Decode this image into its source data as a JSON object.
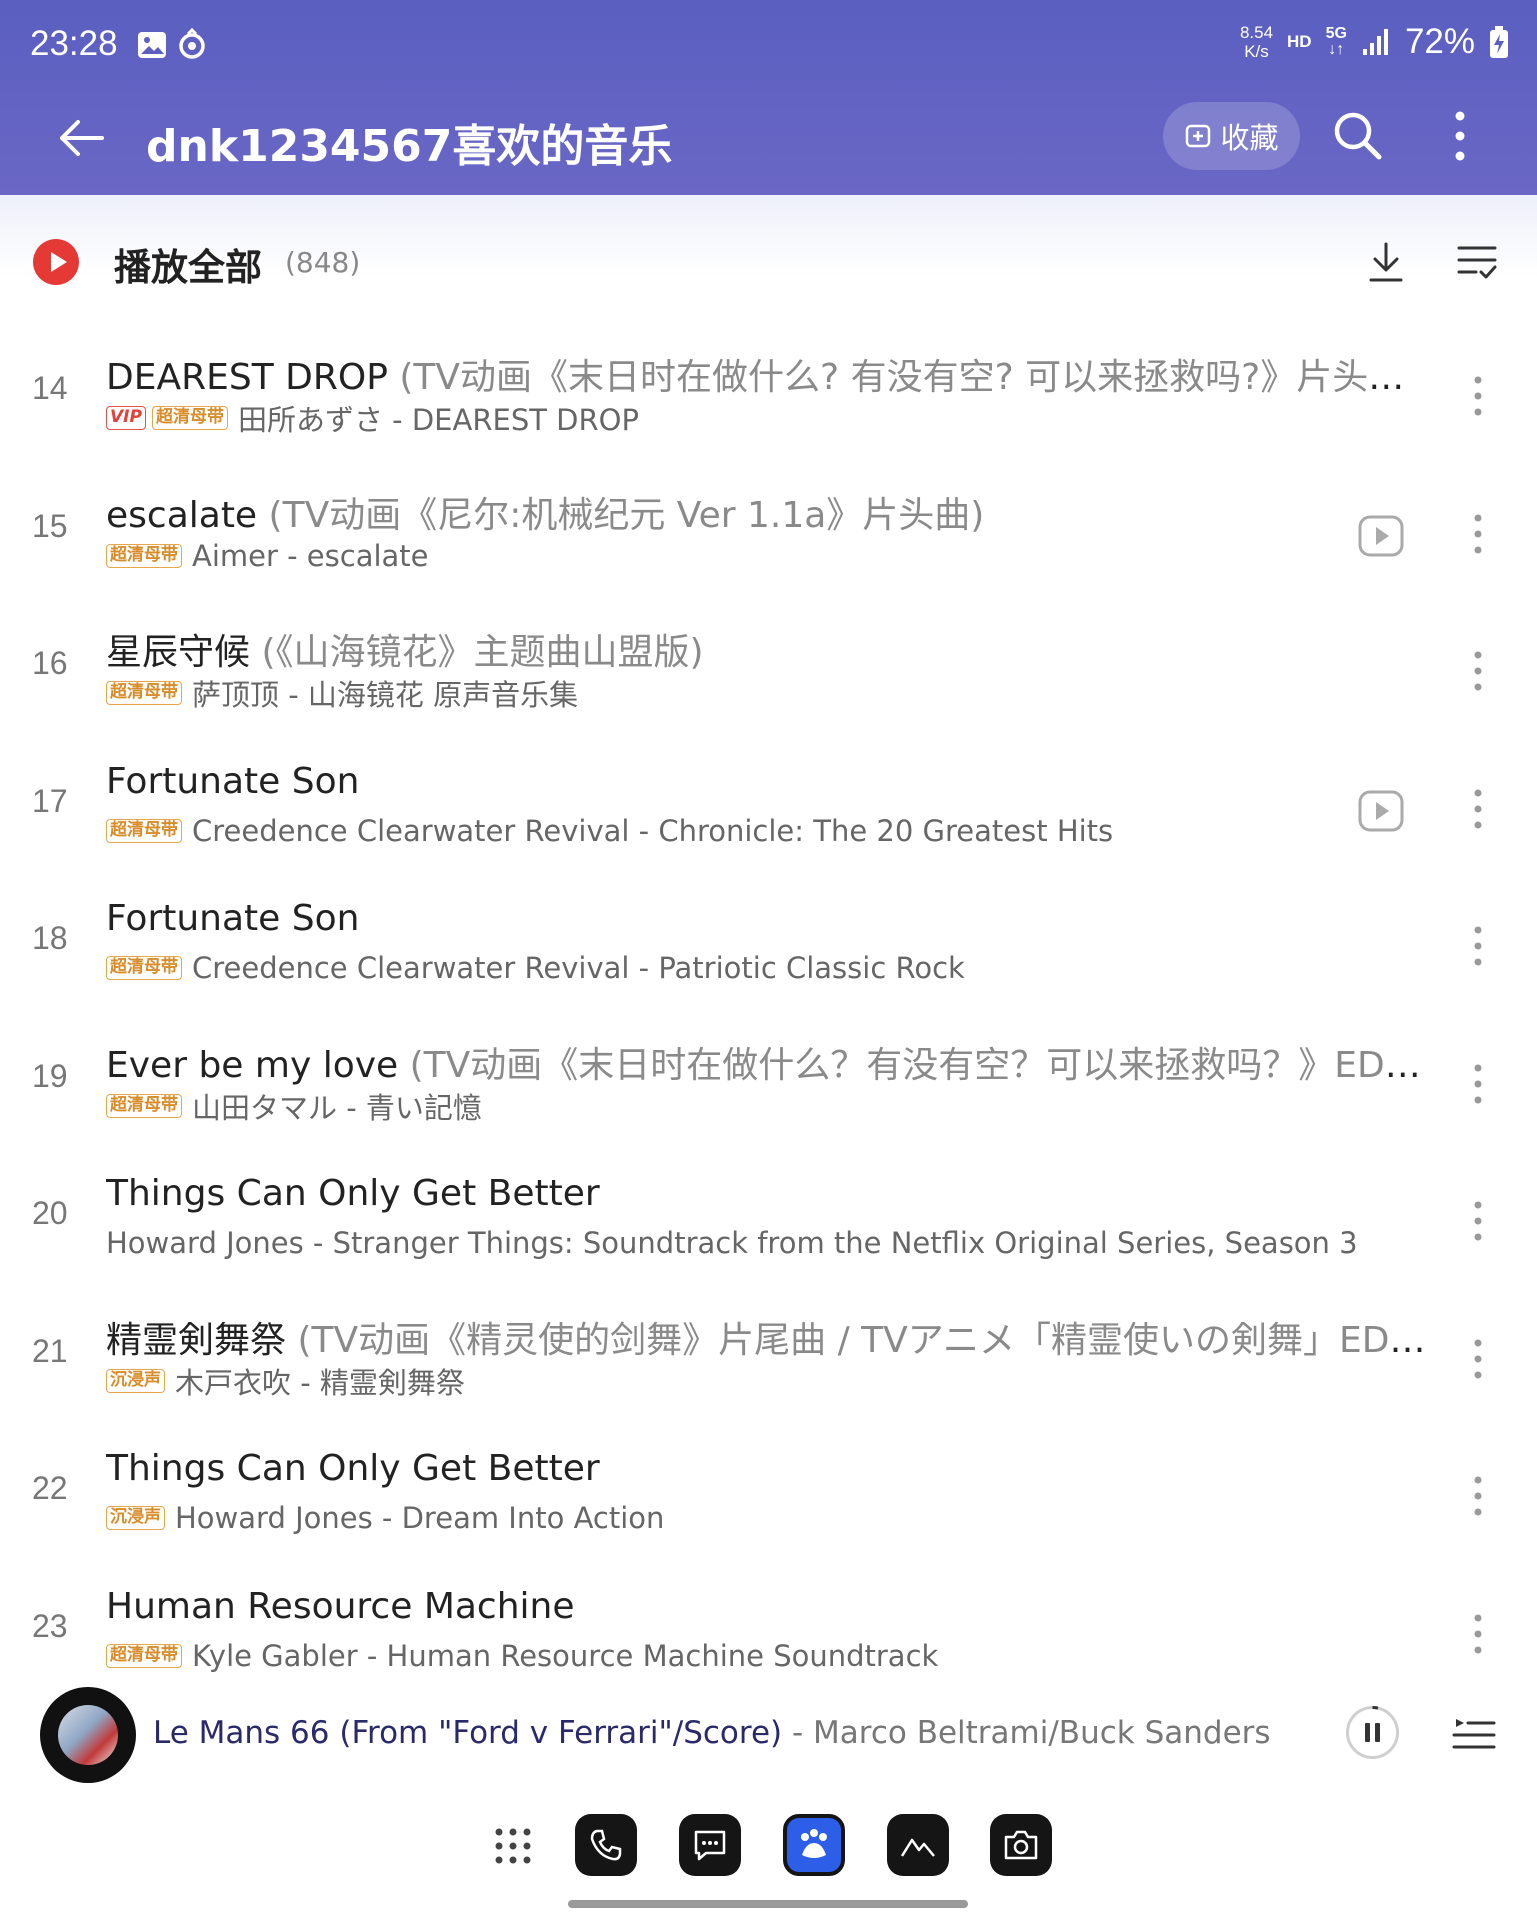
{
  "status_bar": {
    "time": "23:28",
    "net_speed_value": "8.54",
    "net_speed_unit": "K/s",
    "hd": "HD",
    "network": "5G",
    "battery": "72%"
  },
  "toolbar": {
    "title": "dnk1234567喜欢的音乐",
    "collect_label": "收藏"
  },
  "play_all": {
    "label": "播放全部",
    "count": "(848)"
  },
  "songs": [
    {
      "index": "14",
      "title": "DEAREST DROP",
      "subtitle": " (TV动画《末日时在做什么? 有没有空? 可以来拯救吗?》片头曲；...",
      "badges": [
        "VIP",
        "超清母带"
      ],
      "artist": "田所あずさ - DEAREST DROP",
      "has_mv": false
    },
    {
      "index": "15",
      "title": "escalate",
      "subtitle": " (TV动画《尼尔:机械纪元 Ver 1.1a》片头曲)",
      "badges": [
        "超清母带"
      ],
      "artist": "Aimer - escalate",
      "has_mv": true
    },
    {
      "index": "16",
      "title": "星辰守候",
      "subtitle": " (《山海镜花》主题曲山盟版)",
      "badges": [
        "超清母带"
      ],
      "artist": "萨顶顶 - 山海镜花 原声音乐集",
      "has_mv": false
    },
    {
      "index": "17",
      "title": "Fortunate Son",
      "subtitle": "",
      "badges": [
        "超清母带"
      ],
      "artist": "Creedence Clearwater Revival - Chronicle: The 20 Greatest Hits",
      "has_mv": true
    },
    {
      "index": "18",
      "title": "Fortunate Son",
      "subtitle": "",
      "badges": [
        "超清母带"
      ],
      "artist": "Creedence Clearwater Revival - Patriotic Classic Rock",
      "has_mv": false
    },
    {
      "index": "19",
      "title": "Ever be my love",
      "subtitle": " (TV动画《末日时在做什么？有没有空？可以来拯救吗？》ED最终...",
      "badges": [
        "超清母带"
      ],
      "artist": "山田タマル - 青い記憶",
      "has_mv": false
    },
    {
      "index": "20",
      "title": "Things Can Only Get Better",
      "subtitle": "",
      "badges": [],
      "artist": "Howard Jones - Stranger Things: Soundtrack from the Netflix Original Series, Season 3",
      "has_mv": false
    },
    {
      "index": "21",
      "title": "精霊剣舞祭",
      "subtitle": " (TV动画《精灵使的剑舞》片尾曲 / TVアニメ「精霊使いの剣舞」EDテ...",
      "badges": [
        "沉浸声"
      ],
      "artist": "木戸衣吹 - 精霊剣舞祭",
      "has_mv": false
    },
    {
      "index": "22",
      "title": "Things Can Only Get Better",
      "subtitle": "",
      "badges": [
        "沉浸声"
      ],
      "artist": "Howard Jones - Dream Into Action",
      "has_mv": false
    },
    {
      "index": "23",
      "title": "Human Resource Machine",
      "subtitle": "",
      "badges": [
        "超清母带"
      ],
      "artist": "Kyle Gabler - Human Resource Machine Soundtrack",
      "has_mv": false
    }
  ],
  "mini_player": {
    "title": "Le Mans 66 (From \"Ford v Ferrari\"/Score)",
    "separator": " - ",
    "artist": "Marco Beltrami/Buck Sanders"
  },
  "colors": {
    "header": "#5a5fc0",
    "play_all_red": "#e53935",
    "badge_orange": "#d98c2a",
    "badge_vip": "#e2403a"
  }
}
